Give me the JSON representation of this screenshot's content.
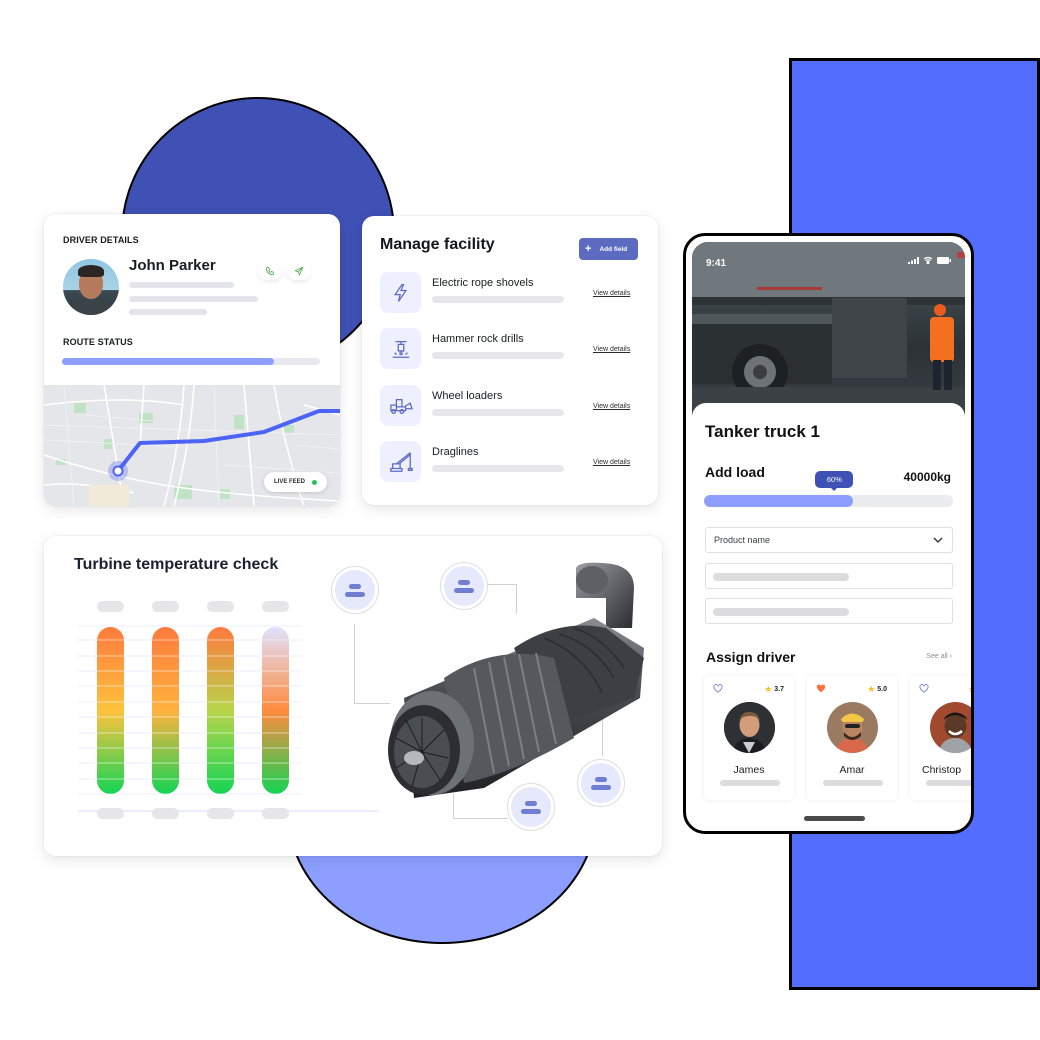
{
  "colors": {
    "accent_dark": "#3f51b5",
    "accent_bright": "#536dfe",
    "accent_light": "#8c9eff",
    "button": "#5c6bc0",
    "live": "#22c55e",
    "heart_active": "#ff6d3a",
    "star": "#fbbf24"
  },
  "driver_card": {
    "section_label": "DRIVER DETAILS",
    "driver_name": "John Parker",
    "call_icon": "phone-icon",
    "message_icon": "send-icon",
    "route_label": "ROUTE STATUS",
    "route_progress": 0.82,
    "map": {
      "live_feed_label": "LIVE FEED"
    }
  },
  "facility_card": {
    "title": "Manage facility",
    "add_button_label": "Add field",
    "items": [
      {
        "name": "Electric rope shovels",
        "icon": "lightning-icon",
        "link": "View details"
      },
      {
        "name": "Hammer rock drills",
        "icon": "jackhammer-icon",
        "link": "View details"
      },
      {
        "name": "Wheel loaders",
        "icon": "wheel-loader-icon",
        "link": "View details"
      },
      {
        "name": "Draglines",
        "icon": "dragline-crane-icon",
        "link": "View details"
      }
    ]
  },
  "turbine_card": {
    "title": "Turbine temperature check",
    "image_subject": "gas turbine engine"
  },
  "chart_data": {
    "type": "bar",
    "title": "Turbine temperature check",
    "categories": [
      "",
      "",
      "",
      ""
    ],
    "series": [
      {
        "name": "temperature",
        "values": [
          100,
          100,
          100,
          100
        ]
      }
    ],
    "gradients": [
      [
        "#ff7a3d",
        "#ffc23d",
        "#14d454"
      ],
      [
        "#ff7a3d",
        "#ffb23d",
        "#14d454"
      ],
      [
        "#ff7a3d",
        "#b8d44a",
        "#14d454"
      ],
      [
        "#dfe2ff",
        "#ff8a3d",
        "#14d454"
      ]
    ],
    "grid": true,
    "ylim": [
      0,
      100
    ],
    "xlabel": "",
    "ylabel": ""
  },
  "phone": {
    "status_time": "9:41",
    "truck_title": "Tanker truck 1",
    "add_load_label": "Add load",
    "load_percent_label": "60%",
    "load_fraction": 0.6,
    "load_weight": "40000kg",
    "product_placeholder": "Product name",
    "assign_driver_label": "Assign driver",
    "see_all_label": "See all",
    "drivers": [
      {
        "name": "James",
        "rating": "3.7",
        "favorite": false
      },
      {
        "name": "Amar",
        "rating": "5.0",
        "favorite": true
      },
      {
        "name": "Christop",
        "rating": "",
        "favorite": false
      }
    ]
  }
}
